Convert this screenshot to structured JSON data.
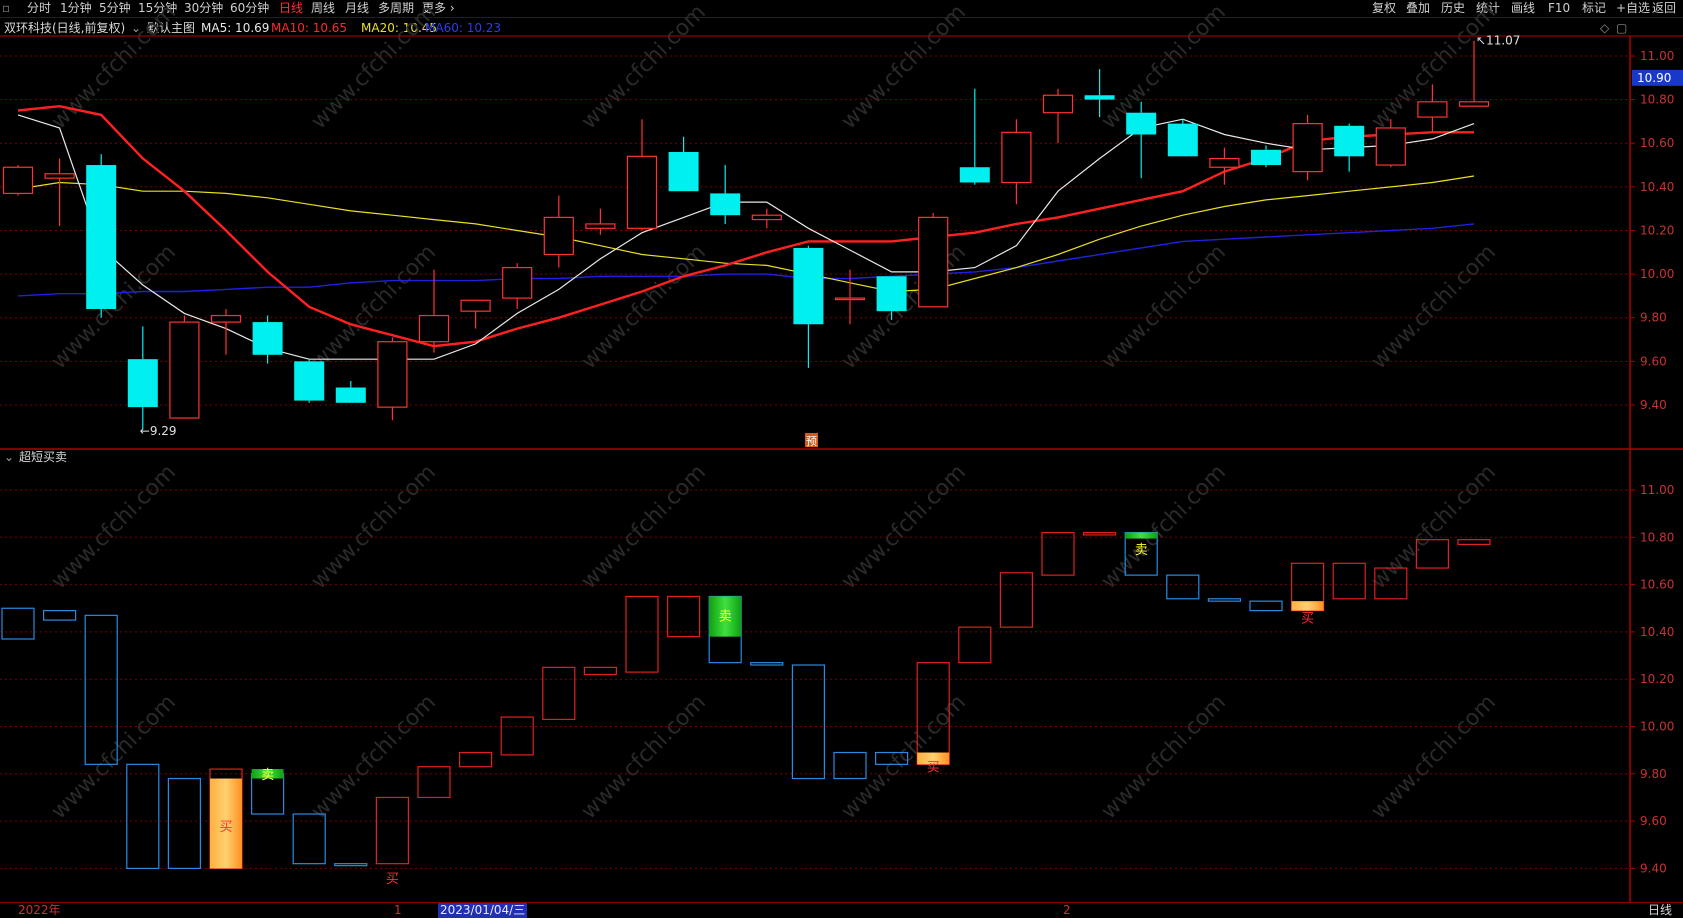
{
  "toolbar": {
    "left": [
      "分时",
      "1分钟",
      "5分钟",
      "15分钟",
      "30分钟",
      "60分钟",
      "日线",
      "周线",
      "月线",
      "多周期",
      "更多 ›"
    ],
    "active_index": 6,
    "right": [
      "复权",
      "叠加",
      "历史",
      "统计",
      "画线",
      "F10",
      "标记",
      "+自选",
      "返回"
    ]
  },
  "chart_title": {
    "stock": "双环科技(日线,前复权)",
    "template": "默认主图",
    "ma5": "MA5: 10.69",
    "ma10": "MA10: 10.65",
    "ma20": "MA20: 10.45",
    "ma60": "MA60: 10.23"
  },
  "sub_title": "超短买卖",
  "colors": {
    "up": "#ff3232",
    "down": "#00f0f0",
    "ma5": "#e8e8e8",
    "ma10": "#ff2020",
    "ma20": "#e8e020",
    "ma60": "#2020e0",
    "grid": "#7a0000",
    "sub_up": "#e02020",
    "sub_down": "#2a8ae0",
    "buy": "#ff9f2a",
    "sell": "#22cc22"
  },
  "price_axis": {
    "main": [
      "11.00",
      "10.80",
      "10.60",
      "10.40",
      "10.20",
      "10.00",
      "9.80",
      "9.60",
      "9.40"
    ],
    "sub": [
      "11.00",
      "10.80",
      "10.60",
      "10.40",
      "10.20",
      "10.00",
      "9.80",
      "9.60",
      "9.40"
    ],
    "last_price": "10.90"
  },
  "labels": {
    "high": "11.07",
    "low": "9.29",
    "forecast": "预",
    "buy": "买",
    "sell": "卖"
  },
  "date_axis": {
    "year": "2022年",
    "m1": "1",
    "current_date": "2023/01/04/三",
    "m2": "2",
    "period": "日线"
  },
  "watermark": "www.cfchi.com",
  "chart_data": {
    "type": "candlestick",
    "y_range": [
      9.26,
      11.18
    ],
    "candles": [
      {
        "o": 10.37,
        "h": 10.5,
        "l": 10.36,
        "c": 10.49
      },
      {
        "o": 10.44,
        "h": 10.53,
        "l": 10.22,
        "c": 10.46
      },
      {
        "o": 10.5,
        "h": 10.55,
        "l": 9.8,
        "c": 9.84
      },
      {
        "o": 9.61,
        "h": 9.76,
        "l": 9.29,
        "c": 9.39
      },
      {
        "o": 9.34,
        "h": 9.81,
        "l": 9.34,
        "c": 9.78
      },
      {
        "o": 9.78,
        "h": 9.84,
        "l": 9.63,
        "c": 9.81
      },
      {
        "o": 9.78,
        "h": 9.81,
        "l": 9.59,
        "c": 9.63
      },
      {
        "o": 9.6,
        "h": 9.61,
        "l": 9.41,
        "c": 9.42
      },
      {
        "o": 9.48,
        "h": 9.51,
        "l": 9.41,
        "c": 9.41
      },
      {
        "o": 9.39,
        "h": 9.71,
        "l": 9.33,
        "c": 9.69
      },
      {
        "o": 9.69,
        "h": 10.02,
        "l": 9.64,
        "c": 9.81
      },
      {
        "o": 9.83,
        "h": 9.88,
        "l": 9.75,
        "c": 9.88
      },
      {
        "o": 9.89,
        "h": 10.05,
        "l": 9.84,
        "c": 10.03
      },
      {
        "o": 10.09,
        "h": 10.36,
        "l": 10.03,
        "c": 10.26
      },
      {
        "o": 10.21,
        "h": 10.3,
        "l": 10.18,
        "c": 10.23
      },
      {
        "o": 10.21,
        "h": 10.71,
        "l": 10.2,
        "c": 10.54
      },
      {
        "o": 10.56,
        "h": 10.63,
        "l": 10.38,
        "c": 10.38
      },
      {
        "o": 10.37,
        "h": 10.5,
        "l": 10.23,
        "c": 10.27
      },
      {
        "o": 10.25,
        "h": 10.3,
        "l": 10.21,
        "c": 10.27
      },
      {
        "o": 10.12,
        "h": 10.13,
        "l": 9.57,
        "c": 9.77
      },
      {
        "o": 9.89,
        "h": 10.02,
        "l": 9.77,
        "c": 9.89
      },
      {
        "o": 9.99,
        "h": 9.99,
        "l": 9.79,
        "c": 9.83
      },
      {
        "o": 9.85,
        "h": 10.28,
        "l": 9.85,
        "c": 10.26
      },
      {
        "o": 10.49,
        "h": 10.85,
        "l": 10.41,
        "c": 10.42
      },
      {
        "o": 10.42,
        "h": 10.71,
        "l": 10.32,
        "c": 10.65
      },
      {
        "o": 10.74,
        "h": 10.85,
        "l": 10.6,
        "c": 10.82
      },
      {
        "o": 10.82,
        "h": 10.94,
        "l": 10.72,
        "c": 10.8
      },
      {
        "o": 10.74,
        "h": 10.79,
        "l": 10.44,
        "c": 10.64
      },
      {
        "o": 10.69,
        "h": 10.71,
        "l": 10.54,
        "c": 10.54
      },
      {
        "o": 10.49,
        "h": 10.58,
        "l": 10.41,
        "c": 10.53
      },
      {
        "o": 10.57,
        "h": 10.59,
        "l": 10.49,
        "c": 10.5
      },
      {
        "o": 10.47,
        "h": 10.73,
        "l": 10.43,
        "c": 10.69
      },
      {
        "o": 10.68,
        "h": 10.69,
        "l": 10.47,
        "c": 10.54
      },
      {
        "o": 10.5,
        "h": 10.71,
        "l": 10.49,
        "c": 10.67
      },
      {
        "o": 10.72,
        "h": 10.87,
        "l": 10.65,
        "c": 10.79
      },
      {
        "o": 10.77,
        "h": 11.07,
        "l": 10.77,
        "c": 10.79
      }
    ],
    "ma5": [
      10.73,
      10.67,
      10.12,
      9.95,
      9.82,
      9.75,
      9.66,
      9.61,
      9.61,
      9.61,
      9.61,
      9.68,
      9.82,
      9.93,
      10.07,
      10.19,
      10.26,
      10.33,
      10.33,
      10.21,
      10.11,
      10.01,
      10.01,
      10.03,
      10.13,
      10.38,
      10.53,
      10.67,
      10.71,
      10.64,
      10.6,
      10.57,
      10.58,
      10.59,
      10.62,
      10.69
    ],
    "ma10": [
      10.75,
      10.77,
      10.73,
      10.53,
      10.38,
      10.2,
      10.01,
      9.85,
      9.77,
      9.72,
      9.67,
      9.69,
      9.75,
      9.8,
      9.86,
      9.92,
      9.99,
      10.04,
      10.1,
      10.15,
      10.15,
      10.15,
      10.17,
      10.19,
      10.23,
      10.26,
      10.3,
      10.34,
      10.38,
      10.47,
      10.53,
      10.61,
      10.63,
      10.64,
      10.65,
      10.65
    ],
    "ma20": [
      10.39,
      10.42,
      10.41,
      10.38,
      10.38,
      10.37,
      10.35,
      10.32,
      10.29,
      10.27,
      10.25,
      10.23,
      10.2,
      10.17,
      10.13,
      10.09,
      10.07,
      10.05,
      10.04,
      10.0,
      9.96,
      9.92,
      9.93,
      9.98,
      10.03,
      10.09,
      10.16,
      10.22,
      10.27,
      10.31,
      10.34,
      10.36,
      10.38,
      10.4,
      10.42,
      10.45
    ],
    "ma60": [
      9.9,
      9.91,
      9.91,
      9.92,
      9.92,
      9.93,
      9.94,
      9.94,
      9.96,
      9.97,
      9.97,
      9.97,
      9.98,
      9.98,
      9.99,
      9.99,
      9.99,
      10.0,
      10.0,
      9.98,
      9.98,
      9.99,
      10.0,
      10.01,
      10.03,
      10.06,
      10.09,
      10.12,
      10.15,
      10.16,
      10.17,
      10.18,
      10.19,
      10.2,
      10.21,
      10.23
    ],
    "sub_bars": [
      {
        "t": 10.5,
        "b": 10.37,
        "u": 0
      },
      {
        "t": 10.49,
        "b": 10.45,
        "u": 0
      },
      {
        "t": 10.47,
        "b": 9.84,
        "u": 0
      },
      {
        "t": 9.84,
        "b": 9.4,
        "u": 0
      },
      {
        "t": 9.78,
        "b": 9.4,
        "u": 0
      },
      {
        "t": 9.82,
        "b": 9.4,
        "u": 1
      },
      {
        "t": 9.8,
        "b": 9.63,
        "u": 0
      },
      {
        "t": 9.63,
        "b": 9.42,
        "u": 0
      },
      {
        "t": 9.42,
        "b": 9.42,
        "u": 0
      },
      {
        "t": 9.7,
        "b": 9.42,
        "u": 1
      },
      {
        "t": 9.83,
        "b": 9.7,
        "u": 1
      },
      {
        "t": 9.89,
        "b": 9.83,
        "u": 1
      },
      {
        "t": 10.04,
        "b": 9.88,
        "u": 1
      },
      {
        "t": 10.25,
        "b": 10.03,
        "u": 1
      },
      {
        "t": 10.25,
        "b": 10.22,
        "u": 1
      },
      {
        "t": 10.55,
        "b": 10.23,
        "u": 1
      },
      {
        "t": 10.55,
        "b": 10.38,
        "u": 1
      },
      {
        "t": 10.55,
        "b": 10.27,
        "u": 0
      },
      {
        "t": 10.27,
        "b": 10.26,
        "u": 0
      },
      {
        "t": 10.26,
        "b": 9.78,
        "u": 0
      },
      {
        "t": 9.89,
        "b": 9.78,
        "u": 0
      },
      {
        "t": 9.89,
        "b": 9.84,
        "u": 0
      },
      {
        "t": 10.27,
        "b": 9.84,
        "u": 1
      },
      {
        "t": 10.42,
        "b": 10.27,
        "u": 1
      },
      {
        "t": 10.65,
        "b": 10.42,
        "u": 1
      },
      {
        "t": 10.82,
        "b": 10.64,
        "u": 1
      },
      {
        "t": 10.82,
        "b": 10.81,
        "u": 1
      },
      {
        "t": 10.82,
        "b": 10.64,
        "u": 0
      },
      {
        "t": 10.64,
        "b": 10.54,
        "u": 0
      },
      {
        "t": 10.54,
        "b": 10.53,
        "u": 0
      },
      {
        "t": 10.53,
        "b": 10.49,
        "u": 0
      },
      {
        "t": 10.69,
        "b": 10.49,
        "u": 1
      },
      {
        "t": 10.69,
        "b": 10.54,
        "u": 1
      },
      {
        "t": 10.67,
        "b": 10.54,
        "u": 1
      },
      {
        "t": 10.79,
        "b": 10.67,
        "u": 1
      },
      {
        "t": 10.79,
        "b": 10.77,
        "u": 1
      }
    ],
    "buy_signals": [
      {
        "i": 5,
        "top": 9.78,
        "bottom": 9.4,
        "label_at": 9.58
      },
      {
        "i": 9,
        "top": null,
        "bottom": null,
        "label_at": 9.36
      },
      {
        "i": 22,
        "top": 9.89,
        "bottom": 9.84,
        "label_at": 9.83
      },
      {
        "i": 31,
        "top": 10.53,
        "bottom": 10.49,
        "label_at": 10.46
      }
    ],
    "sell_signals": [
      {
        "i": 6,
        "top": 9.82,
        "bottom": 9.78,
        "label_at": 9.8
      },
      {
        "i": 17,
        "top": 10.55,
        "bottom": 10.38,
        "label_at": 10.47
      },
      {
        "i": 27,
        "top": 10.82,
        "bottom": 10.8,
        "label_at": 10.75
      }
    ]
  }
}
